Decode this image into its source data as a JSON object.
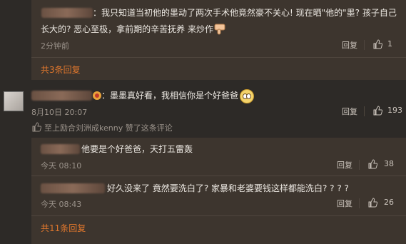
{
  "thread_top": {
    "comment_text_line1": "：我只知道当初他的墨动了两次手术他竟然豪不关心! 现在晒\"他的\"墨? 孩子自己",
    "comment_text_line2": "长大的? 恶心至极，拿前期的辛苦抚养 来炒作",
    "time": "2分钟前",
    "reply_label": "回复",
    "like_count": "1",
    "more_replies": "共3条回复"
  },
  "main_comment": {
    "text": "：墨墨真好看，我相信你是个好爸爸",
    "date": "8月10日 20:07",
    "reply_label": "回复",
    "like_count": "193",
    "liked_by": "至上励合刘洲成kenny 赞了这条评论"
  },
  "replies": [
    {
      "text": "他要是个好爸爸，天打五雷轰",
      "time": "今天 08:10",
      "reply_label": "回复",
      "like_count": "38"
    },
    {
      "text": "好久没来了 竟然要洗白了? 家暴和老婆要钱这样都能洗白? ? ? ?",
      "time": "今天 08:43",
      "reply_label": "回复",
      "like_count": "26"
    }
  ],
  "more_replies_bottom": "共11条回复",
  "colors": {
    "background": "#2d2a27",
    "panel": "#3d352e",
    "accent_orange": "#e0772d",
    "meta_gray": "#9a928a"
  }
}
